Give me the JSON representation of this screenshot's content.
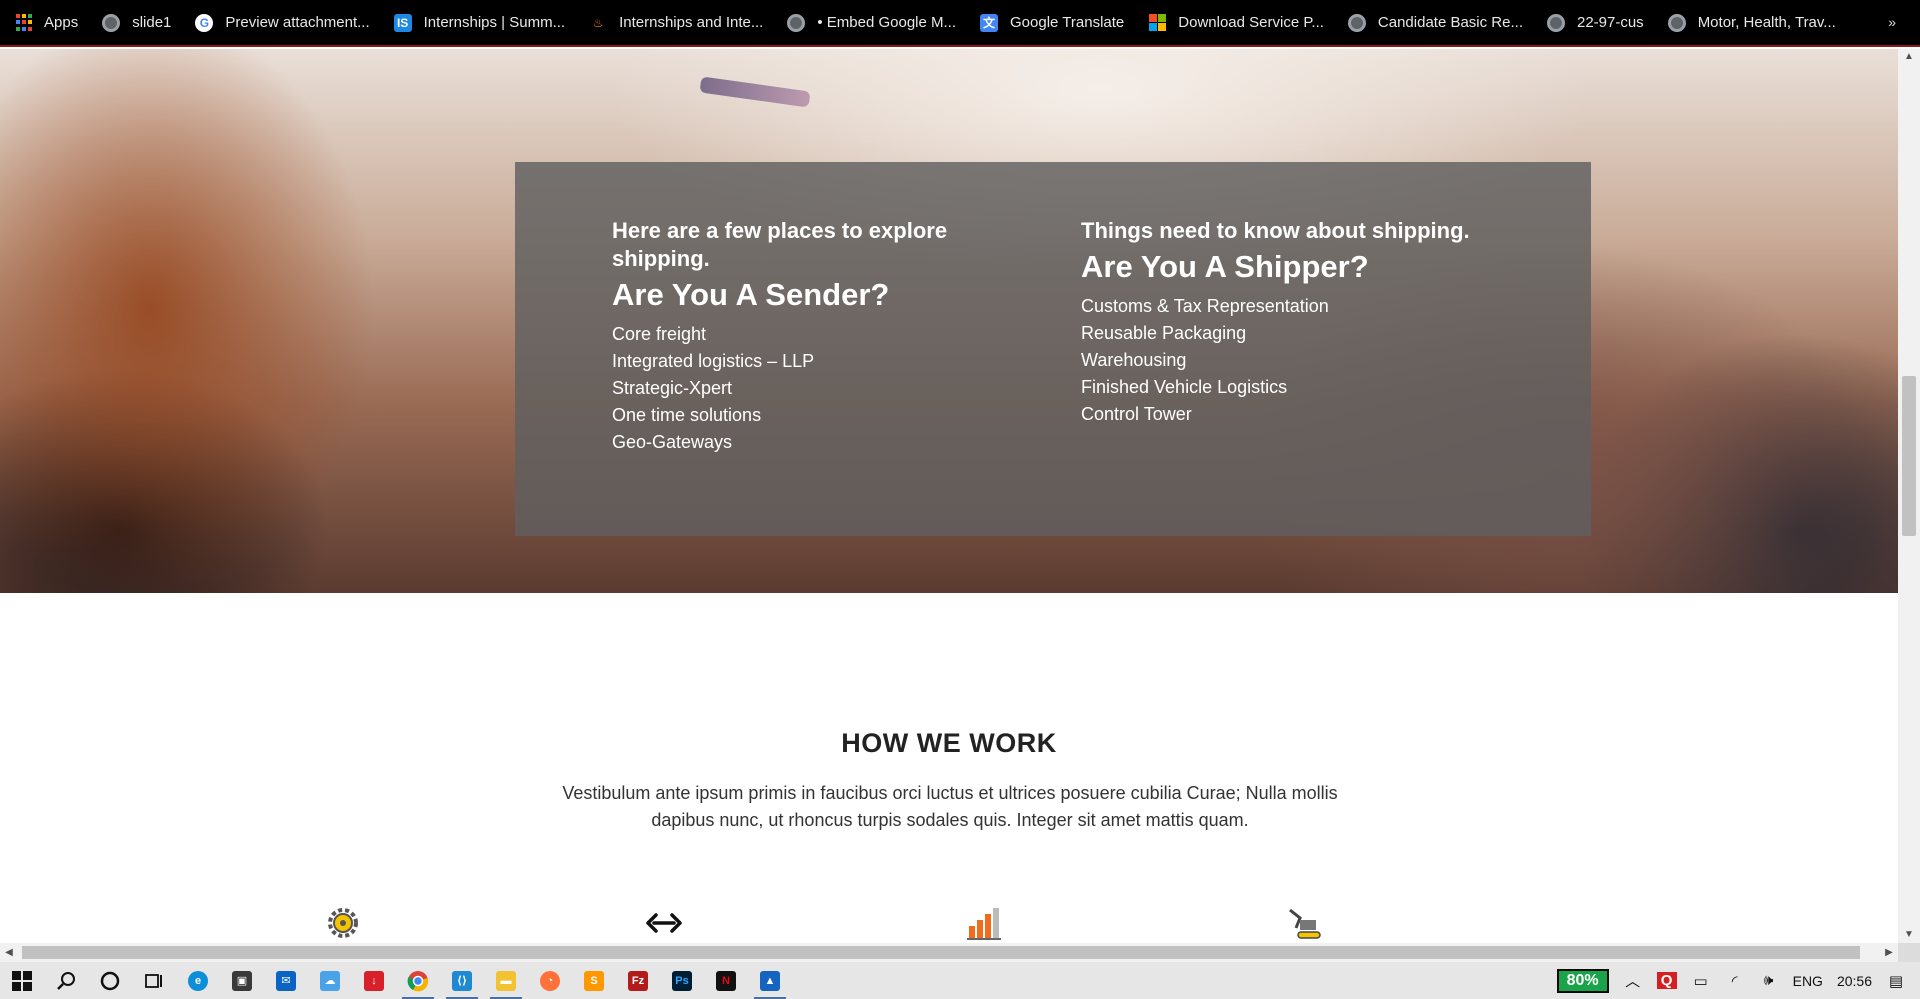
{
  "bookmarks": {
    "items": [
      {
        "label": "Apps",
        "icon": "apps-grid-icon"
      },
      {
        "label": "slide1",
        "icon": "globe-icon"
      },
      {
        "label": "Preview attachment...",
        "icon": "google-icon"
      },
      {
        "label": "Internships | Summ...",
        "icon": "is-icon"
      },
      {
        "label": "Internships and Inte...",
        "icon": "flame-icon"
      },
      {
        "label": "• Embed Google M...",
        "icon": "globe-icon"
      },
      {
        "label": "Google Translate",
        "icon": "translate-icon"
      },
      {
        "label": "Download Service P...",
        "icon": "microsoft-icon"
      },
      {
        "label": "Candidate Basic Re...",
        "icon": "globe-icon"
      },
      {
        "label": "22-97-cus",
        "icon": "globe-icon"
      },
      {
        "label": "Motor, Health, Trav...",
        "icon": "globe-icon"
      }
    ],
    "more": "»"
  },
  "hero": {
    "sender": {
      "subtitle": "Here are a few places to explore shipping.",
      "title": "Are You A Sender?",
      "items": [
        "Core freight",
        "Integrated logistics – LLP",
        "Strategic-Xpert",
        "One time solutions",
        "Geo-Gateways"
      ]
    },
    "shipper": {
      "subtitle": "Things need to know about shipping.",
      "title": "Are You A Shipper?",
      "items": [
        "Customs & Tax Representation",
        "Reusable Packaging",
        "Warehousing",
        "Finished Vehicle Logistics",
        "Control Tower"
      ]
    }
  },
  "how": {
    "title": "HOW WE WORK",
    "text": "Vestibulum ante ipsum primis in faucibus orci luctus et ultrices posuere cubilia Curae; Nulla mollis dapibus nunc, ut rhoncus turpis sodales quis. Integer sit amet mattis quam.",
    "features": [
      "gear-icon",
      "link-arrows-icon",
      "bar-chart-icon",
      "excavator-icon"
    ]
  },
  "taskbar": {
    "battery": "80%",
    "language": "ENG",
    "time": "20:56"
  },
  "colors": {
    "overlay": "#5f5f5f",
    "accent_orange": "#f26b1d",
    "taskbar": "#e6e6e6"
  }
}
